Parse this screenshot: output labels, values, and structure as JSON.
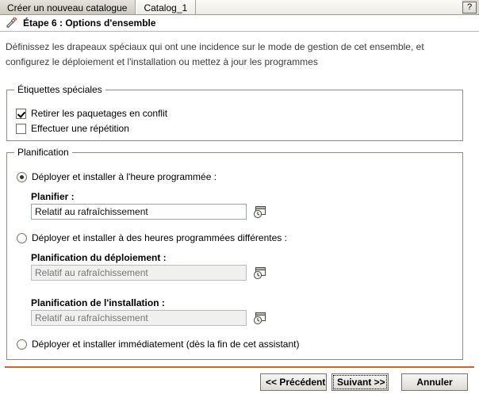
{
  "window": {
    "tabs": [
      {
        "label": "Créer un nouveau catalogue",
        "active": false
      },
      {
        "label": "Catalog_1",
        "active": true
      }
    ],
    "help_label": "?"
  },
  "step": {
    "icon": "wand-icon",
    "title": "Étape 6 : Options d'ensemble",
    "description": "Définissez les drapeaux spéciaux qui ont une incidence sur le mode de gestion de cet ensemble, et configurez le déploiement et l'installation ou mettez à jour les programmes"
  },
  "flags_group": {
    "legend": "Étiquettes spéciales",
    "checkboxes": [
      {
        "label": "Retirer les paquetages en conflit",
        "checked": true
      },
      {
        "label": "Effectuer une répétition",
        "checked": false
      }
    ]
  },
  "schedule_group": {
    "legend": "Planification",
    "options": [
      {
        "label": "Déployer et installer à l'heure programmée :",
        "selected": true
      },
      {
        "label": "Déployer et installer à des heures programmées différentes :",
        "selected": false
      },
      {
        "label": "Déployer et installer immédiatement (dès la fin de cet assistant)",
        "selected": false
      }
    ],
    "fields": [
      {
        "label": "Planifier :",
        "value": "Relatif au rafraîchissement",
        "placeholder": "Relatif au rafraîchissement",
        "disabled": false,
        "picker_icon": "calendar-clock-icon"
      },
      {
        "label": "Planification du déploiement :",
        "value": "",
        "placeholder": "Relatif au rafraîchissement",
        "disabled": true,
        "picker_icon": "calendar-clock-icon"
      },
      {
        "label": "Planification de l'installation :",
        "value": "",
        "placeholder": "Relatif au rafraîchissement",
        "disabled": true,
        "picker_icon": "calendar-clock-icon"
      }
    ]
  },
  "footer": {
    "back_label": "<< Précédent",
    "next_label": "Suivant >>",
    "cancel_label": "Annuler",
    "separator_color": "#d8622a"
  }
}
